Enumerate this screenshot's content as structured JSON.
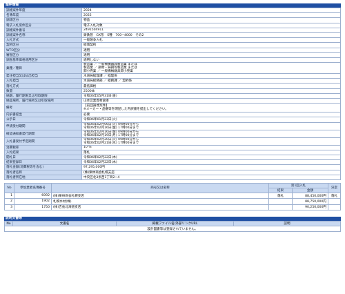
{
  "info": {
    "title": "案件情報",
    "rows": [
      {
        "k": "調達案件年度",
        "v": "2024"
      },
      {
        "k": "名簿年度",
        "v": "2022"
      },
      {
        "k": "調達区分",
        "v": "物品"
      },
      {
        "k": "電子入札案件区分",
        "v": "電子入札対象"
      },
      {
        "k": "調達案件番号",
        "v": "2491504911"
      },
      {
        "k": "調達案件名称",
        "v": "鋳鉄管　GX形　S種　700~4000　その2"
      },
      {
        "k": "入札方式",
        "v": "一般競争入札"
      },
      {
        "k": "契約区分",
        "v": "総価契約"
      },
      {
        "k": "WTO区分",
        "v": "適用"
      },
      {
        "k": "審査区分",
        "v": "適用"
      },
      {
        "k": "調査基準価格適用区分",
        "v": "適用しない"
      }
    ],
    "gyoshu_k": "業種／種目",
    "gyoshu_lines": [
      "製造業 ／ 一般機械器具製造業 または",
      "製造業 ／ 鋼材・鋳鋼等製造業 または",
      "卸小売業 ／ 一般機械器具卸小売業"
    ],
    "rows2": [
      {
        "k": "発注担当又は払出担当",
        "v": "水道局経理課 ／ 経理係"
      },
      {
        "k": "入札担当",
        "v": "水道局総務部 ／ 総務課 ／ 契約係"
      },
      {
        "k": "落札方式",
        "v": "最低価格"
      },
      {
        "k": "数量",
        "v": "2500本"
      },
      {
        "k": "納期、履行期限又は引取期限",
        "v": "令和06年05月31日(金)"
      },
      {
        "k": "納品場所、履行場所又は引取場所",
        "v": "山本営業資材倉庫"
      }
    ],
    "biko_k": "備考",
    "biko_lines": [
      "【前回調達案件】",
      "※メーカー・品番等を明記した内訳書を提出してください。"
    ],
    "rows3": [
      {
        "k": "内訳書提出",
        "v": "必要"
      },
      {
        "k": "公示日",
        "v": "令和06年01月23日(火)"
      }
    ],
    "shinsei_k": "申請受付期間",
    "shinsei_lines": [
      "令和06年02月06日(火) 09時00分から",
      "令和06年02月16日(金) 17時00分まで"
    ],
    "kakunin_k": "確認通知書発行期間",
    "kakunin_lines": [
      "令和06年02月16日(金) 09時00分から",
      "令和06年02月19日(月) 17時00分まで"
    ],
    "nyusatsu_k": "入札書受付予定期間",
    "nyusatsu_lines": [
      "令和06年02月20日(火) 09時00分から",
      "令和06年02月21日(水) 17時00分まで"
    ],
    "rows4": [
      {
        "k": "消費税率",
        "v": "10 %"
      },
      {
        "k": "入札結果",
        "v": "落札"
      },
      {
        "k": "開札日",
        "v": "令和06年02月22日(木)"
      },
      {
        "k": "結果登録日",
        "v": "令和06年02月22日(木)"
      },
      {
        "k": "落札金額(消費税等を含む)",
        "v": "97,295,000円"
      },
      {
        "k": "落札者名称",
        "v": "(株)栗林商会札幌支店"
      },
      {
        "k": "落札者所在地",
        "v": "中央区北3条西1丁目2−4"
      }
    ]
  },
  "bids": {
    "headers": {
      "no": "No",
      "reg": "参加業者名簿番号",
      "name": "商号又は名称",
      "round": "第1回入札",
      "result": "結果",
      "amount": "金額",
      "decision": "決定"
    },
    "rows": [
      {
        "no": "1",
        "reg": "6092",
        "name": "(株)栗林商会札幌支店",
        "result": "落札",
        "amount": "88,450,000円",
        "decision": "落札"
      },
      {
        "no": "2",
        "reg": "1902",
        "name": "札幌水材(株)",
        "result": "",
        "amount": "88,750,000円",
        "decision": ""
      },
      {
        "no": "3",
        "reg": "1750",
        "name": "(株)吉長北海道支店",
        "result": "",
        "amount": "90,250,000円",
        "decision": ""
      }
    ]
  },
  "docs": {
    "title": "説明文書等",
    "headers": {
      "no": "No",
      "name": "文書名",
      "file": "掲載ファイル名/外部リンクURL",
      "desc": "説明"
    },
    "empty": "設計図書等は登録されていません。"
  }
}
